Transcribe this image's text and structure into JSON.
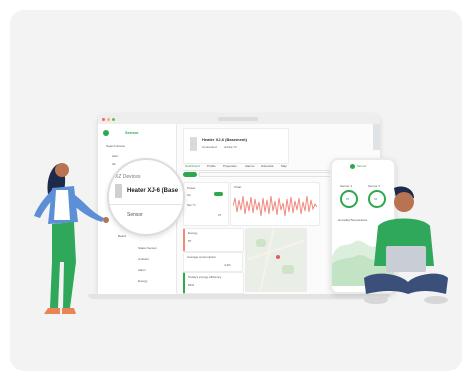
{
  "laptop": {
    "sidebar": {
      "logo_text": "Sensor",
      "search_placeholder": "Search device",
      "items": [
        "Alert",
        "All",
        "All Devices",
        "Heater XJ-6 (Basement)",
        "Sensor",
        "Board",
        "Status Sensor",
        "Ambient",
        "Alarm",
        "Energy"
      ]
    },
    "device": {
      "title": "Heater XJ-6 (Basement)",
      "status": "Connected",
      "id": "sn01a-73"
    },
    "tabs": [
      "Dashboard",
      "Profile",
      "Properties",
      "Alarms",
      "Historical",
      "Map"
    ],
    "widgets": {
      "power_label": "Power",
      "power_value": "On",
      "set_label": "Set °C",
      "set_value": "27",
      "set_unit": "°C",
      "temp_label": "Chart",
      "energy_label": "Energy",
      "energy_value": "87",
      "avg_label": "Average consumption",
      "avg_value": "4.4%",
      "efficiency_label": "Today's energy efficiency",
      "efficiency_value": "82%"
    }
  },
  "zoom": {
    "header": "XZ Devices",
    "device": "Heater XJ-6 (Base",
    "sub": "Sensor"
  },
  "phone": {
    "app_name": "Sensor",
    "gauge_a_label": "Sensor 1",
    "gauge_a_value": "87",
    "gauge_b_label": "Sensor 2",
    "gauge_b_value": "66",
    "chart_label": "Humidity/Temperature"
  },
  "colors": {
    "accent": "#2ea84f",
    "chart_red": "#f08a80",
    "card_bg": "#f3f3f3"
  }
}
